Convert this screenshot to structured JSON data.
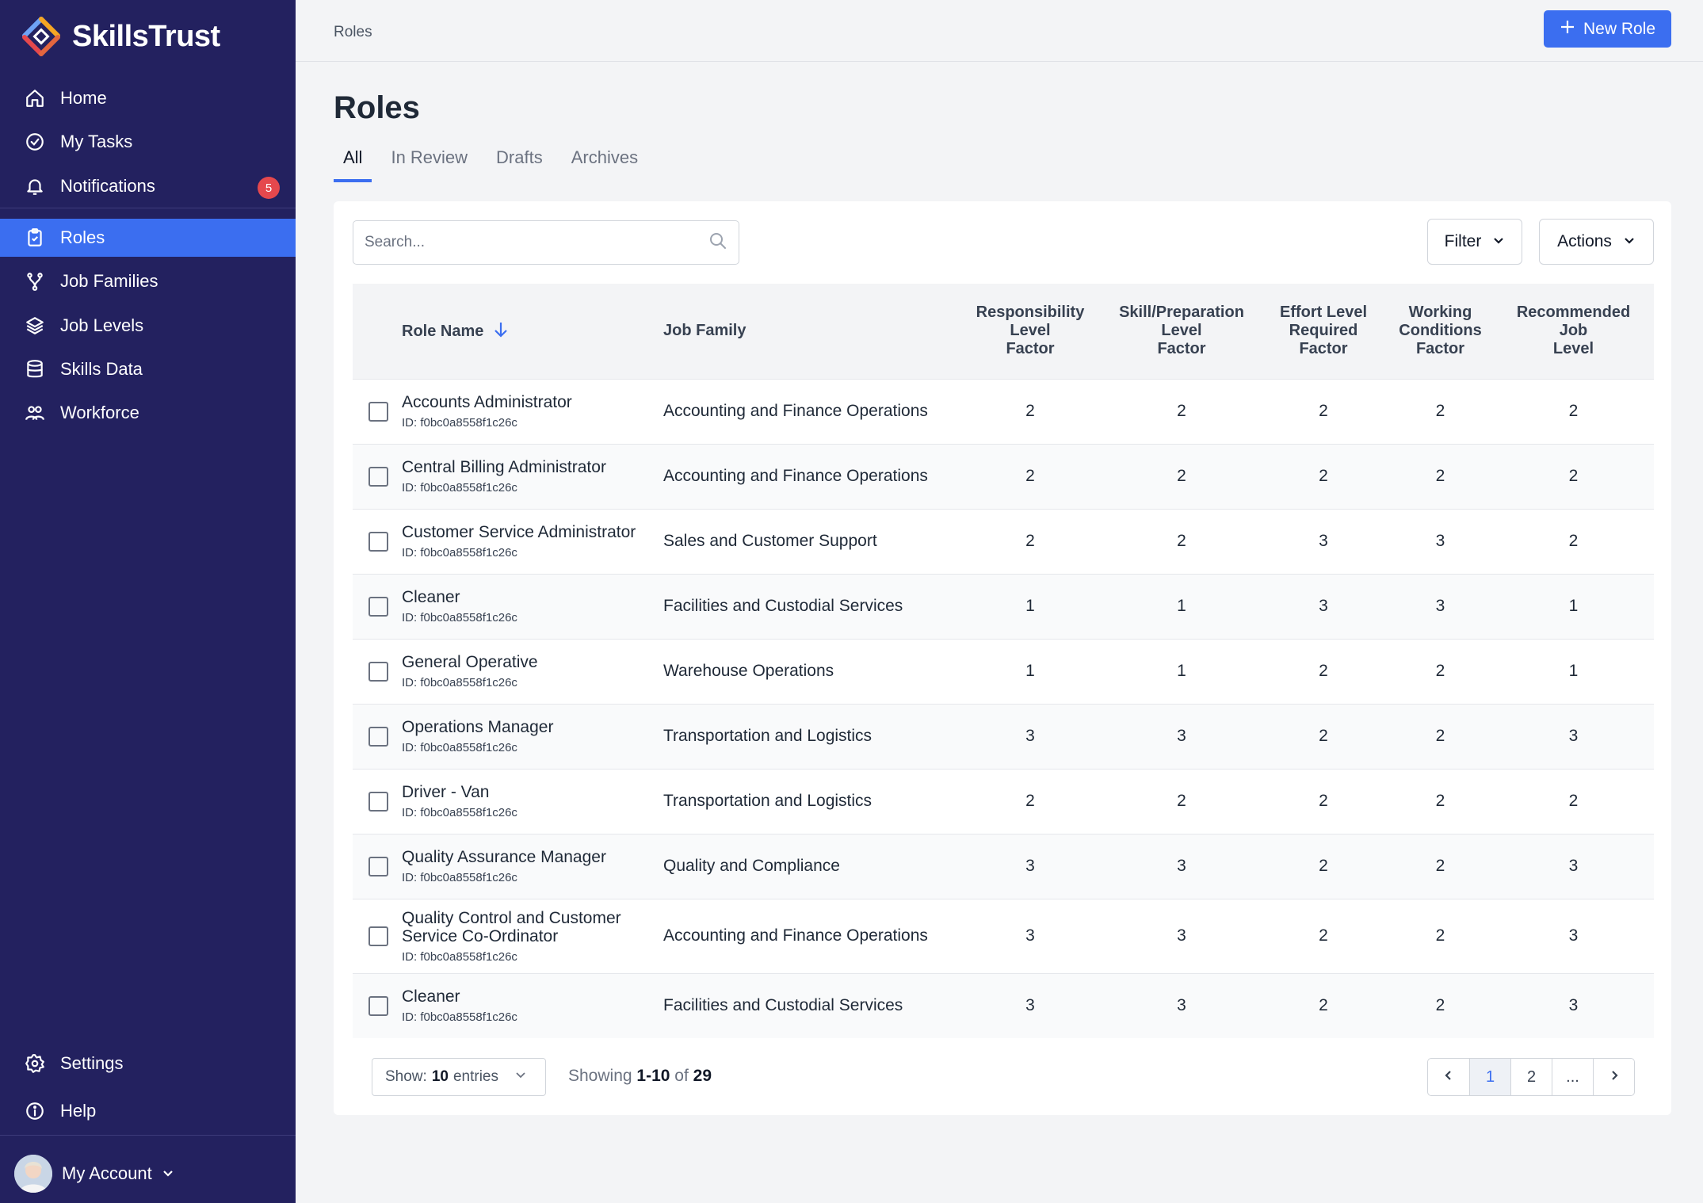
{
  "brand": {
    "name": "SkillsTrust"
  },
  "sidebar": {
    "items": [
      {
        "label": "Home",
        "icon": "home-icon"
      },
      {
        "label": "My Tasks",
        "icon": "check-circle-icon"
      },
      {
        "label": "Notifications",
        "icon": "bell-icon",
        "badge": "5"
      },
      {
        "label": "Roles",
        "icon": "clipboard-icon",
        "active": true
      },
      {
        "label": "Job Families",
        "icon": "branch-icon"
      },
      {
        "label": "Job Levels",
        "icon": "layers-icon"
      },
      {
        "label": "Skills Data",
        "icon": "database-icon"
      },
      {
        "label": "Workforce",
        "icon": "users-icon"
      }
    ],
    "settings": "Settings",
    "help": "Help",
    "account": "My Account"
  },
  "header": {
    "breadcrumb": "Roles",
    "new_role": "New Role"
  },
  "page": {
    "title": "Roles",
    "tabs": [
      "All",
      "In Review",
      "Drafts",
      "Archives"
    ]
  },
  "toolbar": {
    "search_placeholder": "Search...",
    "filter": "Filter",
    "actions": "Actions"
  },
  "table": {
    "headers": {
      "role_name": "Role Name",
      "job_family": "Job Family",
      "responsibility": [
        "Responsibility",
        "Level",
        "Factor"
      ],
      "skill": [
        "Skill/Preparation",
        "Level",
        "Factor"
      ],
      "effort": [
        "Effort Level",
        "Required",
        "Factor"
      ],
      "working": [
        "Working",
        "Conditions",
        "Factor"
      ],
      "recommended": [
        "Recommended",
        "Job",
        "Level"
      ]
    },
    "rows": [
      {
        "name": "Accounts Administrator",
        "id": "ID: f0bc0a8558f1c26c",
        "family": "Accounting and Finance Operations",
        "v": [
          "2",
          "2",
          "2",
          "2",
          "2"
        ]
      },
      {
        "name": "Central Billing Administrator",
        "id": "ID: f0bc0a8558f1c26c",
        "family": "Accounting and Finance Operations",
        "v": [
          "2",
          "2",
          "2",
          "2",
          "2"
        ]
      },
      {
        "name": "Customer Service Administrator",
        "id": "ID: f0bc0a8558f1c26c",
        "family": "Sales and Customer Support",
        "v": [
          "2",
          "2",
          "3",
          "3",
          "2"
        ]
      },
      {
        "name": "Cleaner",
        "id": "ID: f0bc0a8558f1c26c",
        "family": "Facilities and Custodial Services",
        "v": [
          "1",
          "1",
          "3",
          "3",
          "1"
        ]
      },
      {
        "name": "General Operative",
        "id": "ID: f0bc0a8558f1c26c",
        "family": "Warehouse Operations",
        "v": [
          "1",
          "1",
          "2",
          "2",
          "1"
        ]
      },
      {
        "name": "Operations Manager",
        "id": "ID: f0bc0a8558f1c26c",
        "family": "Transportation and Logistics",
        "v": [
          "3",
          "3",
          "2",
          "2",
          "3"
        ]
      },
      {
        "name": "Driver - Van",
        "id": "ID: f0bc0a8558f1c26c",
        "family": "Transportation and Logistics",
        "v": [
          "2",
          "2",
          "2",
          "2",
          "2"
        ]
      },
      {
        "name": "Quality Assurance Manager",
        "id": "ID: f0bc0a8558f1c26c",
        "family": "Quality and Compliance",
        "v": [
          "3",
          "3",
          "2",
          "2",
          "3"
        ]
      },
      {
        "name": "Quality Control and Customer Service Co-Ordinator",
        "id": "ID: f0bc0a8558f1c26c",
        "family": "Accounting and Finance Operations",
        "v": [
          "3",
          "3",
          "2",
          "2",
          "3"
        ]
      },
      {
        "name": "Cleaner",
        "id": "ID: f0bc0a8558f1c26c",
        "family": "Facilities and Custodial Services",
        "v": [
          "3",
          "3",
          "2",
          "2",
          "3"
        ]
      }
    ]
  },
  "footer": {
    "show_prefix": "Show:",
    "show_count": "10",
    "show_suffix": "entries",
    "showing_prefix": "Showing",
    "showing_range": "1-10",
    "showing_of": "of",
    "showing_total": "29",
    "pages": [
      "1",
      "2",
      "..."
    ]
  },
  "colors": {
    "sidebar": "#23215f",
    "accent": "#3b6ef0",
    "badge": "#e5484d"
  }
}
